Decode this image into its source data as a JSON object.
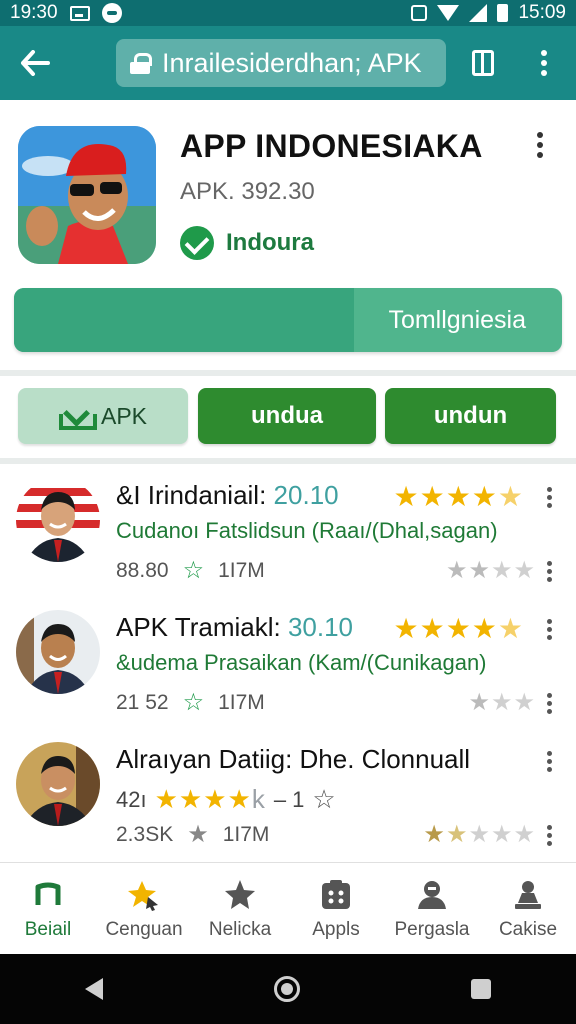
{
  "status_bar": {
    "time_left": "19:30",
    "time_right": "15:09"
  },
  "app_bar": {
    "url_text": "Inrailesiderdhan; APK"
  },
  "app": {
    "title": "APP INDONESIAKA",
    "version": "APK. 392.30",
    "verified_label": "Indoura",
    "progress_label": "Tomllgniesia",
    "progress_fraction": 0.62
  },
  "actions": {
    "apk_label": "APK",
    "btn2_label": "undua",
    "btn3_label": "undun"
  },
  "list": [
    {
      "title": "&I Irindaniail:",
      "version": "20.10",
      "subtitle": "Cudanoı Fatslidsun (Raaı/(Dhal,sagan)",
      "count": "88.80",
      "size": "1I7M"
    },
    {
      "title": "APK Tramiakl:",
      "version": "30.10",
      "subtitle": "&udema Prasaikan (Kam/(Cunikagan)",
      "count": "21 52",
      "size": "1I7M"
    },
    {
      "title": "Alraıyan Datiig: Dhe. Clonnuall",
      "rating_prefix": "42ı",
      "rating_suffix": "– 1",
      "count": "2.3SK",
      "size": "1I7M"
    }
  ],
  "bottom_nav": [
    {
      "label": "Beiail",
      "icon": "music-note-icon"
    },
    {
      "label": "Cenguan",
      "icon": "star-cursor-icon"
    },
    {
      "label": "Nelicka",
      "icon": "star-icon"
    },
    {
      "label": "Appls",
      "icon": "apps-icon"
    },
    {
      "label": "Pergasla",
      "icon": "person-icon"
    },
    {
      "label": "Cakise",
      "icon": "stamp-icon"
    }
  ],
  "colors": {
    "app_bar": "#198987",
    "status_bar": "#0e6e70",
    "accent_green": "#2e8b2f",
    "star_gold": "#f2b400"
  }
}
